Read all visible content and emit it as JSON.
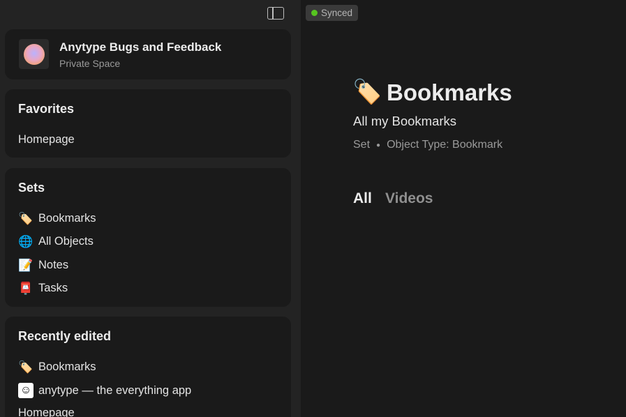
{
  "sidebar": {
    "space": {
      "title": "Anytype Bugs and Feedback",
      "subtitle": "Private Space"
    },
    "favorites": {
      "title": "Favorites",
      "items": [
        {
          "label": "Homepage"
        }
      ]
    },
    "sets": {
      "title": "Sets",
      "items": [
        {
          "emoji": "🏷️",
          "label": "Bookmarks"
        },
        {
          "emoji": "🌐",
          "label": "All Objects"
        },
        {
          "emoji": "📝",
          "label": "Notes"
        },
        {
          "emoji": "📮",
          "label": "Tasks"
        }
      ]
    },
    "recent": {
      "title": "Recently edited",
      "items": [
        {
          "emoji": "🏷️",
          "label": "Bookmarks"
        },
        {
          "emoji": "☺",
          "label": "anytype — the everything app"
        },
        {
          "label": "Homepage"
        }
      ]
    }
  },
  "main": {
    "sync_status": "Synced",
    "page": {
      "icon": "🏷️",
      "title": "Bookmarks",
      "description": "All my Bookmarks",
      "meta_type": "Set",
      "meta_object_type": "Object Type: Bookmark"
    },
    "tabs": [
      {
        "label": "All",
        "active": true
      },
      {
        "label": "Videos",
        "active": false
      }
    ]
  },
  "colors": {
    "background": "#1a1a1a",
    "sidebar": "#232323",
    "synced_dot": "#56c520"
  }
}
